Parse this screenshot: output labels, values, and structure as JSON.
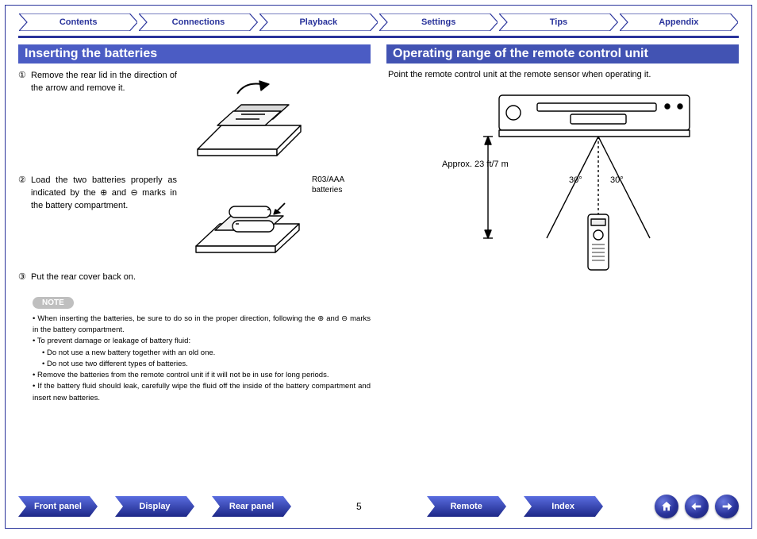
{
  "nav": {
    "tabs": [
      "Contents",
      "Connections",
      "Playback",
      "Settings",
      "Tips",
      "Appendix"
    ]
  },
  "left": {
    "title": "Inserting the batteries",
    "steps": {
      "s1": {
        "num": "①",
        "text": "Remove the rear lid in the direction of the arrow and remove it."
      },
      "s2": {
        "num": "②",
        "text": "Load the two batteries properly as indicated by the ⊕ and ⊖ marks in the battery compartment.",
        "fig_label_l1": "R03/AAA",
        "fig_label_l2": "batteries"
      },
      "s3": {
        "num": "③",
        "text": "Put the rear cover back on."
      }
    },
    "note_badge": "NOTE",
    "notes": {
      "n1": "When inserting the batteries, be sure to do so in the proper direction, following the ⊕ and ⊖ marks in the battery compartment.",
      "n2": "To prevent damage or leakage of battery fluid:",
      "n2a": "Do not use a new battery together with an old one.",
      "n2b": "Do not use two different types of batteries.",
      "n3": "Remove the batteries from the remote control unit if it will not be in use for long periods.",
      "n4": "If the battery fluid should leak, carefully wipe the fluid off the inside of the battery compartment and insert new batteries."
    }
  },
  "right": {
    "title": "Operating range of the remote control unit",
    "text": "Point the remote control unit at the remote sensor when operating it.",
    "range_label": "Approx. 23 ft/7 m",
    "angle_left": "30°",
    "angle_right": "30°"
  },
  "bottom": {
    "buttons": {
      "b1": "Front panel",
      "b2": "Display",
      "b3": "Rear panel",
      "b4": "Remote",
      "b5": "Index"
    },
    "page": "5"
  }
}
